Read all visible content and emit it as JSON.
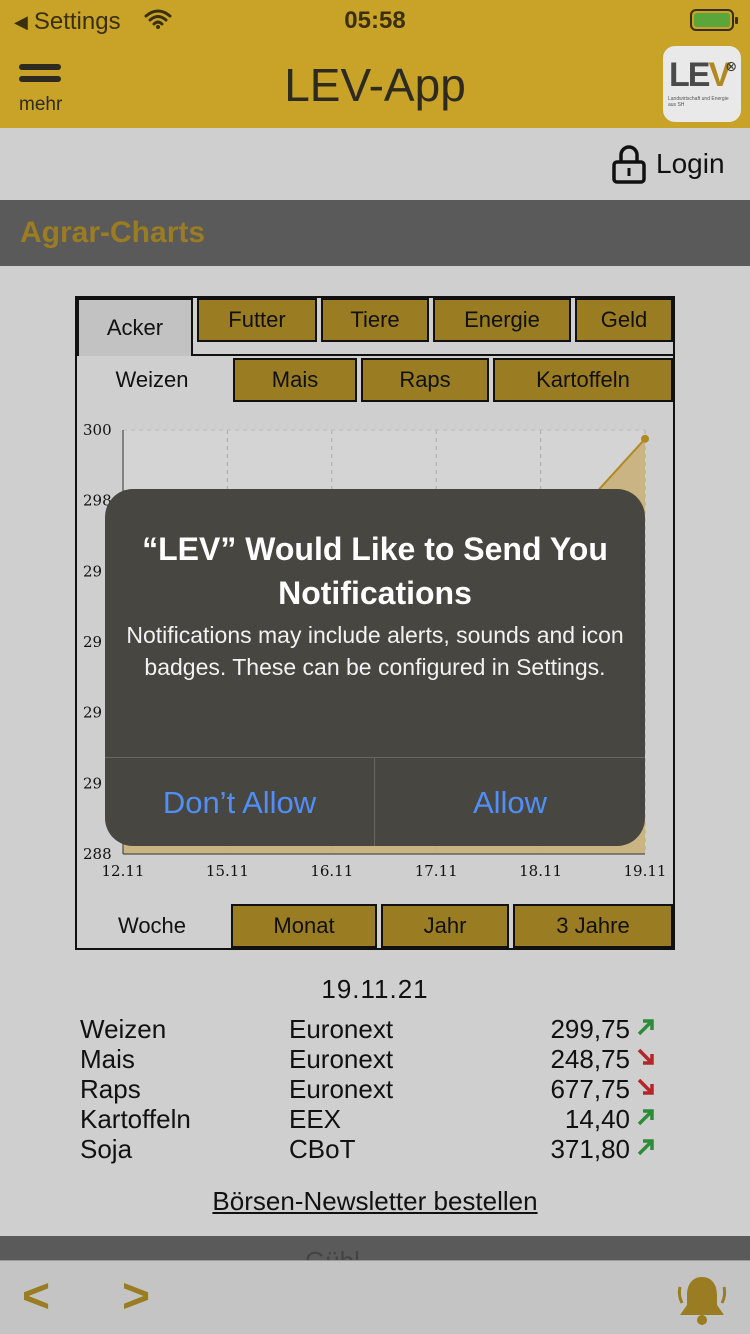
{
  "status_bar": {
    "back_label": "Settings",
    "time": "05:58"
  },
  "header": {
    "menu_label": "mehr",
    "title": "LEV-App",
    "logo_text": "LEV",
    "logo_tagline": "Landwirtschaft und Energie aus SH"
  },
  "login": {
    "label": "Login"
  },
  "section": {
    "title": "Agrar-Charts"
  },
  "tabs": {
    "categories": [
      "Acker",
      "Futter",
      "Tiere",
      "Energie",
      "Geld"
    ],
    "products": [
      "Weizen",
      "Mais",
      "Raps",
      "Kartoffeln"
    ],
    "periods": [
      "Woche",
      "Monat",
      "Jahr",
      "3 Jahre"
    ]
  },
  "chart_data": {
    "type": "area",
    "x": [
      "12.11",
      "15.11",
      "16.11",
      "17.11",
      "18.11",
      "19.11"
    ],
    "y_ticks_visible": [
      "300",
      "298",
      "29",
      "29",
      "29",
      "29",
      "288"
    ],
    "ylim": [
      288,
      300
    ],
    "series": [
      {
        "values": [
          288.6,
          null,
          null,
          null,
          296.5,
          299.75
        ]
      }
    ],
    "colors": {
      "fill": "#c9b07a",
      "line": "#b08a20"
    }
  },
  "quotes": {
    "date": "19.11.21",
    "rows": [
      {
        "name": "Weizen",
        "market": "Euronext",
        "value": "299,75",
        "trend": "up"
      },
      {
        "name": "Mais",
        "market": "Euronext",
        "value": "248,75",
        "trend": "down"
      },
      {
        "name": "Raps",
        "market": "Euronext",
        "value": "677,75",
        "trend": "down"
      },
      {
        "name": "Kartoffeln",
        "market": "EEX",
        "value": "14,40",
        "trend": "up"
      },
      {
        "name": "Soja",
        "market": "CBoT",
        "value": "371,80",
        "trend": "up"
      }
    ],
    "colors": {
      "up": "#2e8b3a",
      "down": "#b3262a"
    }
  },
  "newsletter": {
    "label": "Börsen-Newsletter bestellen"
  },
  "footer": {
    "strip_text": "Gübl",
    "prev_label": "<",
    "next_label": ">"
  },
  "alert": {
    "title": "“LEV” Would Like to Send You Notifications",
    "message": "Notifications may include alerts, sounds and icon badges. These can be configured in Settings.",
    "deny_label": "Don’t Allow",
    "allow_label": "Allow"
  },
  "colors": {
    "brand": "#c9a327",
    "accent_dark": "#9a7c22",
    "section_bg": "#5a5a5a",
    "alert_button": "#4f8ff7"
  }
}
